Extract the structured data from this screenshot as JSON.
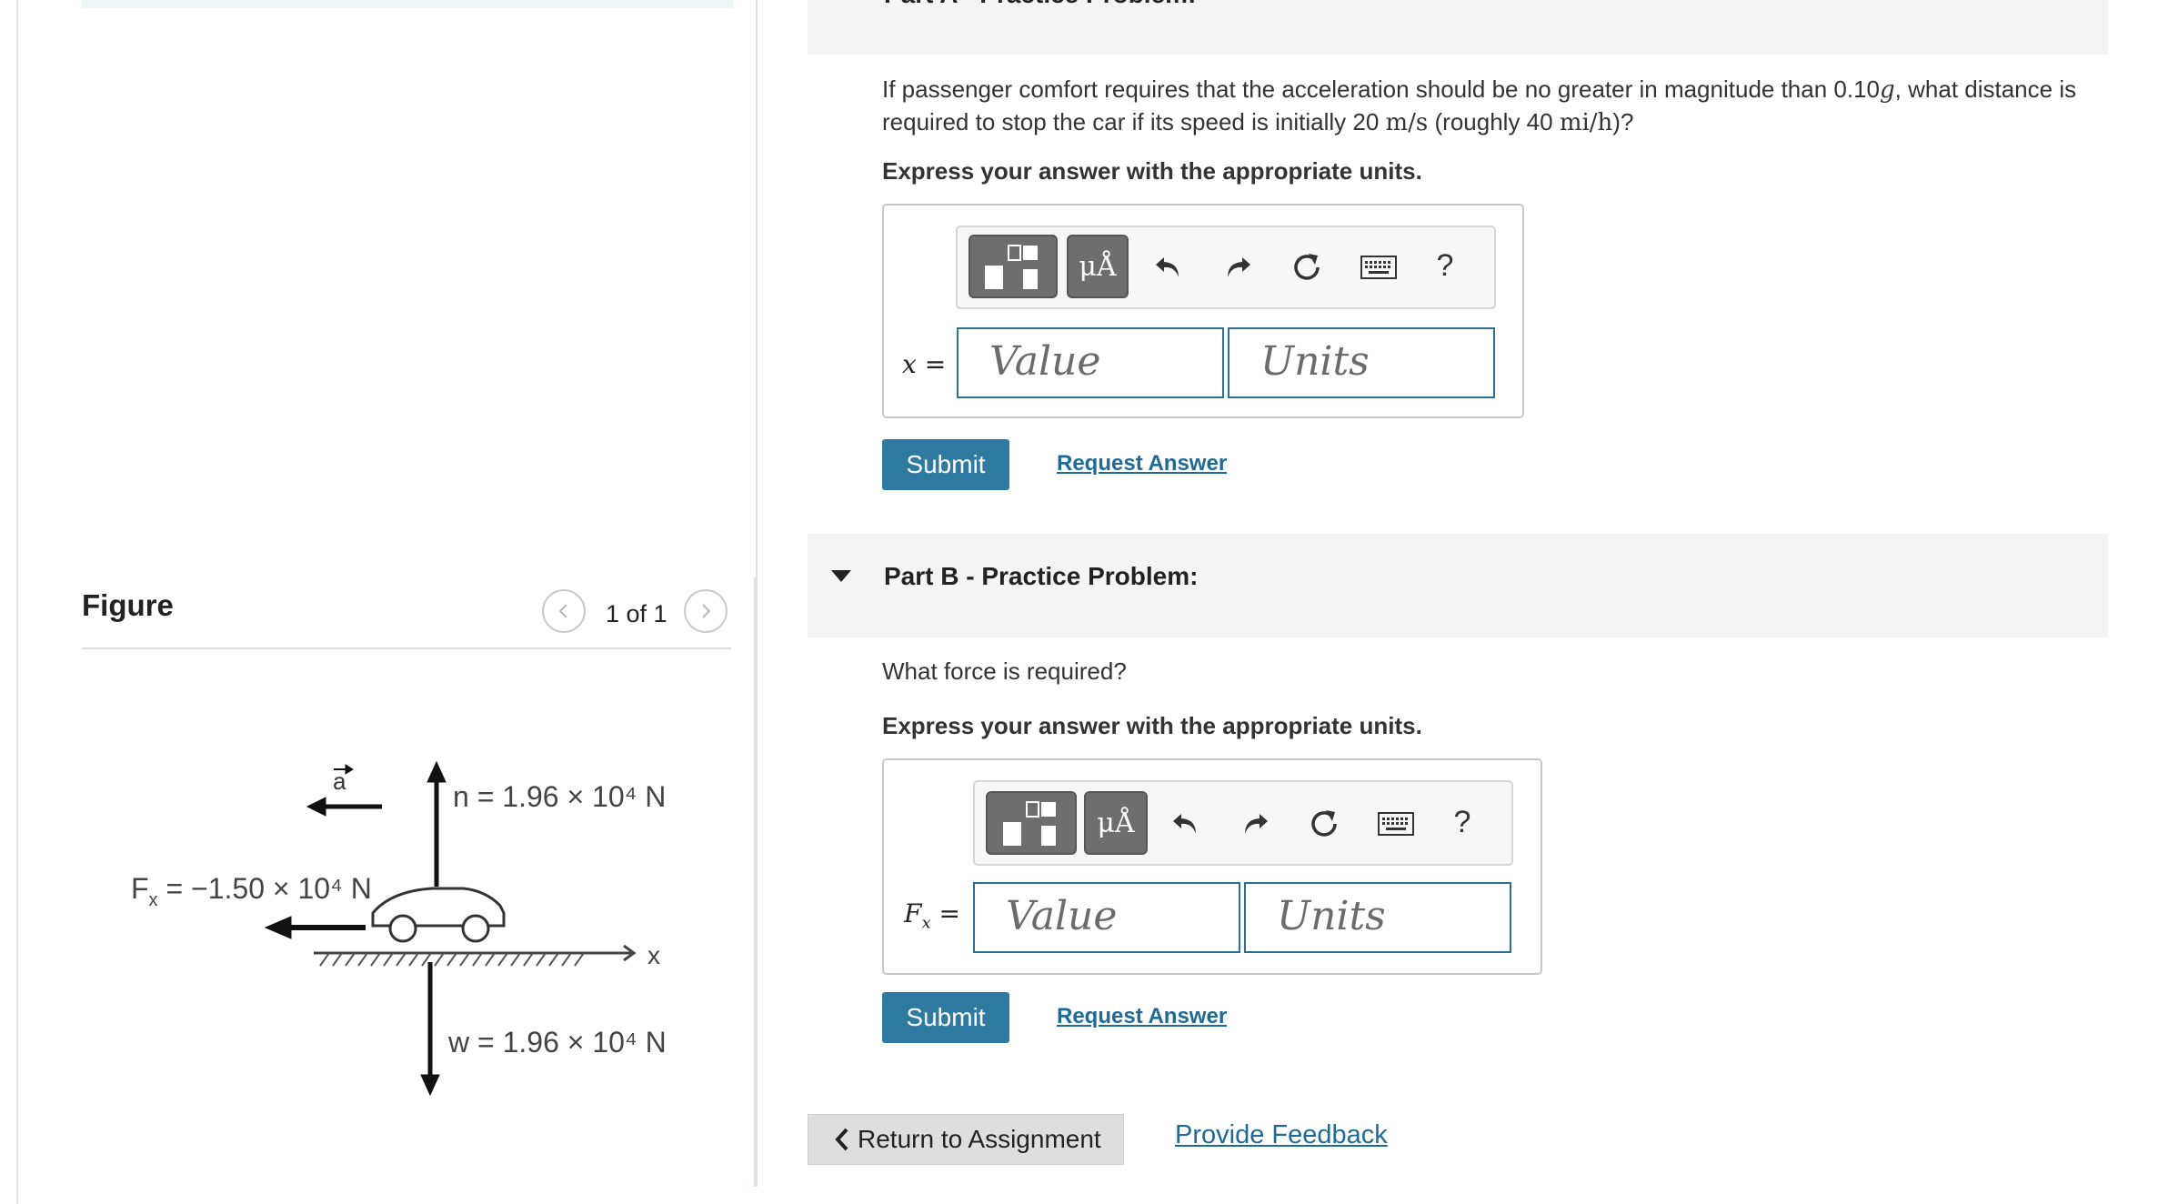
{
  "figure": {
    "title": "Figure",
    "counter": "1 of 1",
    "labels": {
      "accel": "a",
      "normal": "n = 1.96 × 10⁴ N",
      "force_prefix": "F",
      "force_sub": "x",
      "force_value": " = −1.50 × 10⁴ N",
      "weight": "w = 1.96 × 10⁴ N",
      "axis": "x"
    }
  },
  "partA": {
    "title": "Part A - Practice Problem:",
    "question_1": "If passenger comfort requires that the acceleration should be no greater in magnitude than 0.10",
    "question_g": "g",
    "question_2": ", what distance is required to stop the car if its speed is initially 20 ",
    "question_unit1": "m/s",
    "question_3": " (roughly 40 ",
    "question_unit2": "mi/h",
    "question_4": ")?",
    "express": "Express your answer with the appropriate units.",
    "var_label": "x =",
    "value_placeholder": "Value",
    "units_placeholder": "Units",
    "submit": "Submit",
    "request": "Request Answer"
  },
  "partB": {
    "title": "Part B - Practice Problem:",
    "question": "What force is required?",
    "express": "Express your answer with the appropriate units.",
    "var_main": "F",
    "var_sub": "x",
    "var_eq": " =",
    "value_placeholder": "Value",
    "units_placeholder": "Units",
    "submit": "Submit",
    "request": "Request Answer"
  },
  "toolbar": {
    "mu_label": "μÅ",
    "help_label": "?",
    "icons": [
      "templates-icon",
      "units-icon",
      "undo-icon",
      "redo-icon",
      "reset-icon",
      "keyboard-icon",
      "help-icon"
    ]
  },
  "footer": {
    "return": "Return to Assignment",
    "feedback": "Provide Feedback"
  },
  "colors": {
    "primary": "#2f7aa1",
    "link": "#1f6a96",
    "field_border": "#2d6e95",
    "header_bg": "#f4f4f4"
  }
}
